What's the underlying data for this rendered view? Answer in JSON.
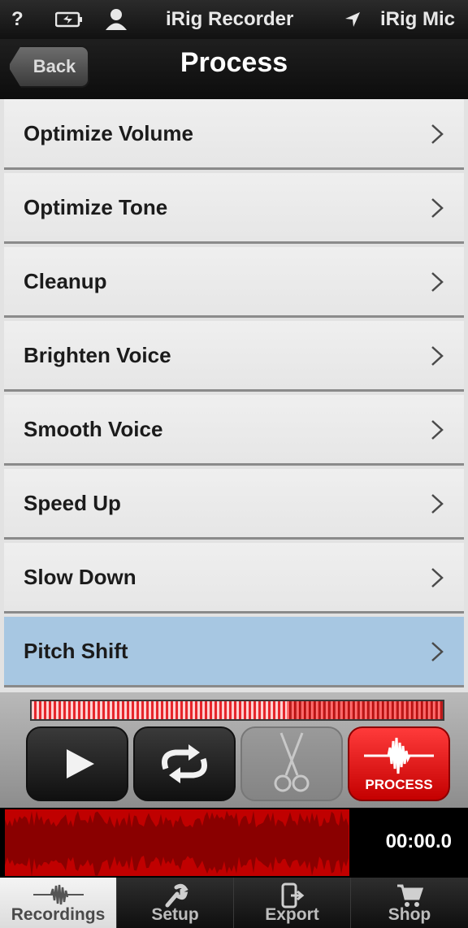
{
  "status_bar": {
    "help": "?",
    "app_name": "iRig Recorder",
    "input": "iRig Mic"
  },
  "nav": {
    "back_label": "Back",
    "title": "Process"
  },
  "menu": {
    "items": [
      {
        "label": "Optimize Volume"
      },
      {
        "label": "Optimize Tone"
      },
      {
        "label": "Cleanup"
      },
      {
        "label": "Brighten Voice"
      },
      {
        "label": "Smooth Voice"
      },
      {
        "label": "Speed Up"
      },
      {
        "label": "Slow Down"
      },
      {
        "label": "Pitch Shift"
      }
    ],
    "selected": "Pitch Shift"
  },
  "transport": {
    "process_label": "PROCESS"
  },
  "waveform": {
    "time": "00:00.0"
  },
  "tabs": {
    "items": [
      {
        "label": "Recordings",
        "icon": "waveform-icon"
      },
      {
        "label": "Setup",
        "icon": "wrench-icon"
      },
      {
        "label": "Export",
        "icon": "export-icon"
      },
      {
        "label": "Shop",
        "icon": "cart-icon"
      }
    ],
    "active": "Recordings"
  },
  "colors": {
    "accent_red": "#d80000",
    "selected_row": "#a7c7e2"
  }
}
